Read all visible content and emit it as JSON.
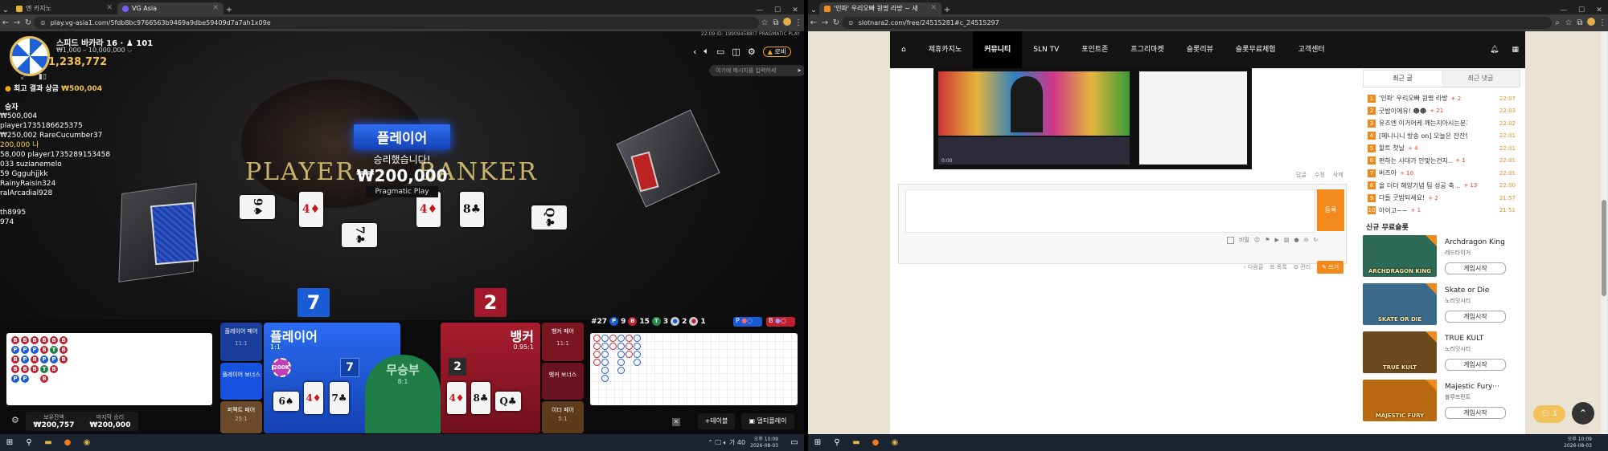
{
  "left_window": {
    "tabs": [
      {
        "label": "엔 카지노",
        "active": false
      },
      {
        "label": "VG Asia",
        "active": true
      }
    ],
    "url": "play.vg-asia1.com/5fdb8bc9766563b9469a9dbe59409d7a7ah1x09e",
    "window_controls": {
      "min": "—",
      "max": "☐",
      "close": "✕"
    }
  },
  "right_window": {
    "tabs": [
      {
        "label": "'인파' 우리오빠 원명 라방 ~ 새",
        "active": true
      }
    ],
    "url": "slotnara2.com/free/24515281#c_24515297"
  },
  "game": {
    "table_name": "스피드 바카라 16 · ♟ 101",
    "bet_limits": "₩1,000 – 10,000,000 ⌵",
    "balance_top": "1,238,772",
    "top_win_label": "최고 결과 상금",
    "top_win_amount": "₩500,004",
    "header_info": "22:09 ID: 199094588!7 PRAGMATIC PLAY",
    "lobby_btn": "로비",
    "chat_placeholder": "여기에 메시지를 입력하세",
    "winners_title": "승자",
    "winners": [
      "₩500,004 player1735186625375",
      "₩250,002 RareCucumber37",
      "200,000 나",
      "58,000 player1735289153458",
      "033 suzianemelo",
      "59 Ggguhjjkk",
      "RainyRaisin324",
      "ralArcadial928",
      "th8995",
      "974"
    ],
    "result_banner": "플레이어",
    "result_msg": "승리했습니다!",
    "result_amount": "₩200,000",
    "result_brand": "Pragmatic Play",
    "player_label_bg": "PLAYER",
    "banker_label_bg": "BANKER",
    "player_score": "7",
    "banker_score": "2",
    "round_no": "#27",
    "counts": {
      "P": "9",
      "B": "15",
      "T": "3",
      "PP": "2",
      "BP": "1"
    },
    "side_bets": {
      "player_pair": "플레이어 페어",
      "player_pair_odds": "11:1",
      "player_bonus": "플레이어 보너스",
      "perfect_pair": "퍼펙트 페어",
      "perfect_pair_odds": "25:1",
      "banker_pair": "뱅커 페어",
      "banker_pair_odds": "11:1",
      "banker_bonus": "뱅커 보너스",
      "either_pair": "이더 페어",
      "either_pair_odds": "5:1"
    },
    "player_box": {
      "label": "플레이어",
      "odds": "1:1",
      "chip": "200K",
      "score": "7"
    },
    "tie_box": {
      "label": "무승부",
      "odds": "8:1"
    },
    "banker_box": {
      "label": "뱅커",
      "odds": "0.95:1",
      "score": "2"
    },
    "balance_label": "보유잔액",
    "balance_value": "₩200,757",
    "last_win_label": "마지막 승리",
    "last_win_value": "₩200,000",
    "add_table": "+테이블",
    "multi_play": "멀티플레이",
    "bead_road": [
      [
        "B",
        "P",
        "B",
        "B",
        "P"
      ],
      [
        "B",
        "P",
        "P",
        "B",
        "P"
      ],
      [
        "B",
        "P",
        "B",
        "B"
      ],
      [
        "B",
        "B",
        "P",
        "T",
        "B"
      ],
      [
        "B",
        "T",
        "P",
        "B"
      ],
      [
        "B",
        "B",
        "B"
      ]
    ],
    "player_cards": [
      "6♠",
      "4♦",
      "7♣"
    ],
    "banker_cards": [
      "4♦",
      "8♣",
      "Q♣"
    ],
    "cards_on_table": [
      "9♠",
      "4♦",
      "7♣",
      "4♦",
      "8♣",
      "Q♣"
    ],
    "colors": {
      "player": "#1a5bd6",
      "banker": "#a3182a",
      "tie": "#1f7d46",
      "accent": "#f2a81d"
    }
  },
  "site": {
    "nav": [
      "⌂",
      "제휴카지노",
      "커뮤니티",
      "SLN TV",
      "포인트존",
      "프그리마켓",
      "슬롯리뷰",
      "슬롯무료체험",
      "고객센터"
    ],
    "active_nav": "커뮤니티",
    "video_time": "0:00",
    "actions": [
      "답글",
      "수정",
      "삭제"
    ],
    "comment_submit": "등록",
    "tool_secret": "비밀",
    "list_btns": [
      "다음글",
      "목록",
      "관리"
    ],
    "write_btn": "쓰기",
    "tabs": [
      "최근 글",
      "최근 댓글"
    ],
    "recent_posts": [
      {
        "n": "1",
        "title": "'인파' 우리오빠 원명 라방",
        "cnt": "+ 2",
        "time": "22:07"
      },
      {
        "n": "2",
        "title": "굿밤이에유! ☻☻",
        "cnt": "+ 21",
        "time": "22:03"
      },
      {
        "n": "3",
        "title": "유즈엔 이거어케 깨는지아시는분?",
        "cnt": "",
        "time": "22:02"
      },
      {
        "n": "4",
        "title": "[메니니니 방송 on] 오늘은 잔잔한 소..",
        "cnt": "",
        "time": "22:01"
      },
      {
        "n": "5",
        "title": "할트 첫날",
        "cnt": "+ 4",
        "time": "22:01"
      },
      {
        "n": "6",
        "title": "편하는 사대가 안맞는건지..",
        "cnt": "+ 1",
        "time": "22:01"
      },
      {
        "n": "7",
        "title": "버즈아",
        "cnt": "+ 10",
        "time": "22:01"
      },
      {
        "n": "8",
        "title": "올 더더 해양기념 팀 성공 축 ..",
        "cnt": "+ 13",
        "time": "22:00"
      },
      {
        "n": "9",
        "title": "다들 굿밤되세요!",
        "cnt": "+ 2",
        "time": "21:57"
      },
      {
        "n": "10",
        "title": "아이고~~",
        "cnt": "+ 1",
        "time": "21:51"
      }
    ],
    "new_free_title": "신규 무료슬롯",
    "games": [
      {
        "title": "Archdragon King",
        "vendor": "레드타이거",
        "btn": "게임시작",
        "thumb": "ARCHDRAGON KING",
        "color": "#2d6a56"
      },
      {
        "title": "Skate or Die",
        "vendor": "노리밋시티",
        "btn": "게임시작",
        "thumb": "SKATE OR DIE",
        "color": "#3b6b8c"
      },
      {
        "title": "TRUE KULT",
        "vendor": "노리밋시티",
        "btn": "게임시작",
        "thumb": "TRUE KULT",
        "color": "#6b4a1e"
      },
      {
        "title": "Majestic Fury···",
        "vendor": "블루프린트",
        "btn": "게임시작",
        "thumb": "MAJESTIC FURY",
        "color": "#b96a10"
      }
    ],
    "chat_count": "1"
  },
  "taskbar": {
    "time_left": "오후 10:09",
    "date_left": "2026-08-03",
    "time_right": "오후 10:09",
    "date_right": "2026-08-03",
    "ime": "가 40"
  }
}
